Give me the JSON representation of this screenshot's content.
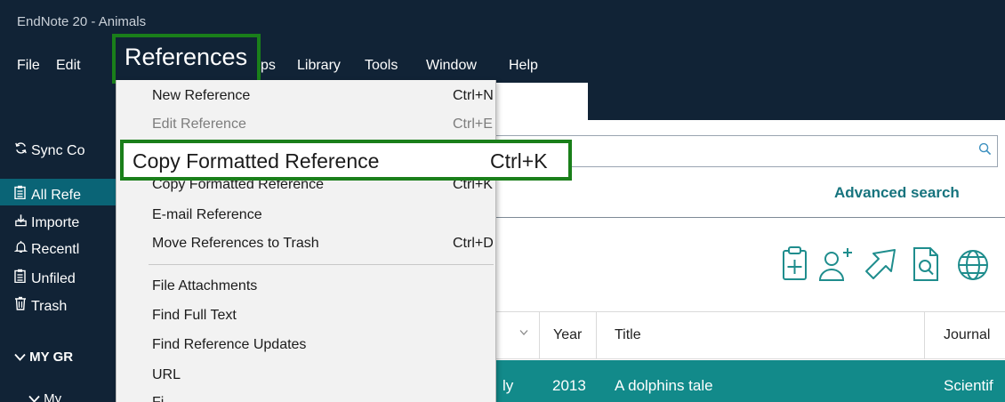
{
  "app": {
    "title": "EndNote 20 - Animals"
  },
  "menubar": [
    "File",
    "Edit",
    "References",
    "Groups",
    "Library",
    "Tools",
    "Window",
    "Help"
  ],
  "menubar_visible": {
    "file": "File",
    "edit": "Edit",
    "ps": "ps",
    "library": "Library",
    "tools": "Tools",
    "window": "Window",
    "help": "Help"
  },
  "callout_references": "References",
  "callout_copy": {
    "label": "Copy Formatted Reference",
    "shortcut": "Ctrl+K"
  },
  "sidebar": {
    "sync": "Sync Co",
    "items": [
      {
        "label": "All Refe",
        "icon": "clipboard-icon",
        "active": true
      },
      {
        "label": "Importe",
        "icon": "import-icon"
      },
      {
        "label": "Recentl",
        "icon": "bell-icon"
      },
      {
        "label": "Unfiled",
        "icon": "clipboard-icon"
      },
      {
        "label": "Trash",
        "icon": "trash-icon"
      }
    ],
    "group_heading": "MY GR",
    "subgroup": "My"
  },
  "dropdown": {
    "items": [
      {
        "label": "New Reference",
        "shortcut": "Ctrl+N",
        "disabled": false
      },
      {
        "label": "Edit Reference",
        "shortcut": "Ctrl+E",
        "disabled": true
      },
      {
        "label": "Copy Formatted Reference",
        "shortcut": "Ctrl+K",
        "disabled": false
      },
      {
        "label": "E-mail Reference",
        "shortcut": "",
        "disabled": false
      },
      {
        "label": "Move References to Trash",
        "shortcut": "Ctrl+D",
        "disabled": false
      },
      {
        "label": "File Attachments",
        "submenu": true
      },
      {
        "label": "Find Full Text",
        "submenu": true
      },
      {
        "label": "Find Reference Updates"
      },
      {
        "label": "URL",
        "submenu": true
      },
      {
        "label": "Fi"
      }
    ]
  },
  "search": {
    "advanced_label": "Advanced search"
  },
  "table": {
    "columns": [
      "Year",
      "Title",
      "Journal"
    ],
    "selected_row": {
      "author_fragment": "ly",
      "year": "2013",
      "title": "A dolphins tale",
      "journal": "Scientif"
    }
  },
  "colors": {
    "chrome": "#112336",
    "accent_teal": "#128a8a",
    "callout_green": "#1a7f1a",
    "link_teal": "#17747e"
  }
}
